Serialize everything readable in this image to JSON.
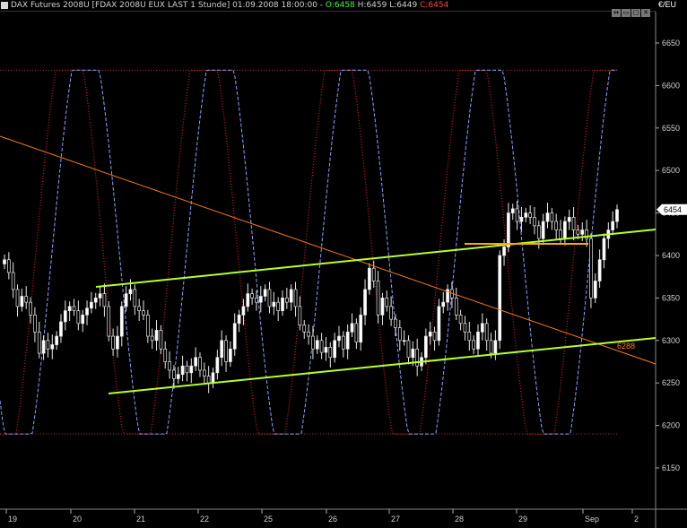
{
  "title_bar": {
    "prefix": "DAX Futures 2008U [FDAX 2008U EUX LAST 1 Stunde]  01.09.2008 18:00:00 - ",
    "open": "O:6458",
    "high": "H:6459",
    "low": "L:6449",
    "close": "C:6454"
  },
  "unit_label": "€/EU",
  "window_buttons": [
    "↔",
    "▭",
    "▢",
    "✕"
  ],
  "chart_data": {
    "type": "candlestick",
    "instrument": "DAX Futures 2008U",
    "ylim": [
      6100,
      6700
    ],
    "y_ticks": [
      6150,
      6200,
      6250,
      6300,
      6350,
      6400,
      6450,
      6500,
      6550,
      6600,
      6650
    ],
    "x_ticks": [
      "19",
      "20",
      "21",
      "22",
      "25",
      "26",
      "27",
      "28",
      "29",
      "Sep",
      "2"
    ],
    "last_price": 6454,
    "tag_6288": 6288,
    "bands": {
      "upper": 6618,
      "lower": 6190
    },
    "candles_close": [
      6395,
      6380,
      6360,
      6340,
      6352,
      6345,
      6330,
      6310,
      6285,
      6300,
      6290,
      6295,
      6305,
      6322,
      6335,
      6340,
      6335,
      6320,
      6330,
      6338,
      6345,
      6350,
      6355,
      6340,
      6305,
      6290,
      6305,
      6340,
      6355,
      6360,
      6340,
      6335,
      6330,
      6305,
      6300,
      6312,
      6290,
      6275,
      6265,
      6255,
      6260,
      6270,
      6262,
      6270,
      6280,
      6265,
      6258,
      6250,
      6262,
      6280,
      6300,
      6275,
      6290,
      6320,
      6330,
      6340,
      6355,
      6350,
      6345,
      6352,
      6360,
      6340,
      6345,
      6335,
      6350,
      6345,
      6360,
      6340,
      6318,
      6310,
      6305,
      6290,
      6300,
      6286,
      6292,
      6280,
      6300,
      6305,
      6290,
      6310,
      6320,
      6298,
      6330,
      6360,
      6385,
      6370,
      6330,
      6350,
      6340,
      6325,
      6315,
      6300,
      6300,
      6280,
      6290,
      6270,
      6280,
      6305,
      6310,
      6300,
      6340,
      6345,
      6360,
      6350,
      6330,
      6320,
      6310,
      6300,
      6290,
      6310,
      6320,
      6300,
      6285,
      6300,
      6400,
      6410,
      6450,
      6455,
      6440,
      6445,
      6450,
      6445,
      6435,
      6420,
      6440,
      6450,
      6440,
      6430,
      6420,
      6440,
      6445,
      6430,
      6425,
      6430,
      6420,
      6350,
      6370,
      6395,
      6420,
      6430,
      6440,
      6454
    ],
    "series": [
      {
        "name": "osc_blue",
        "color": "#8aa0ff"
      },
      {
        "name": "osc_red",
        "color": "#cc2222"
      }
    ]
  }
}
